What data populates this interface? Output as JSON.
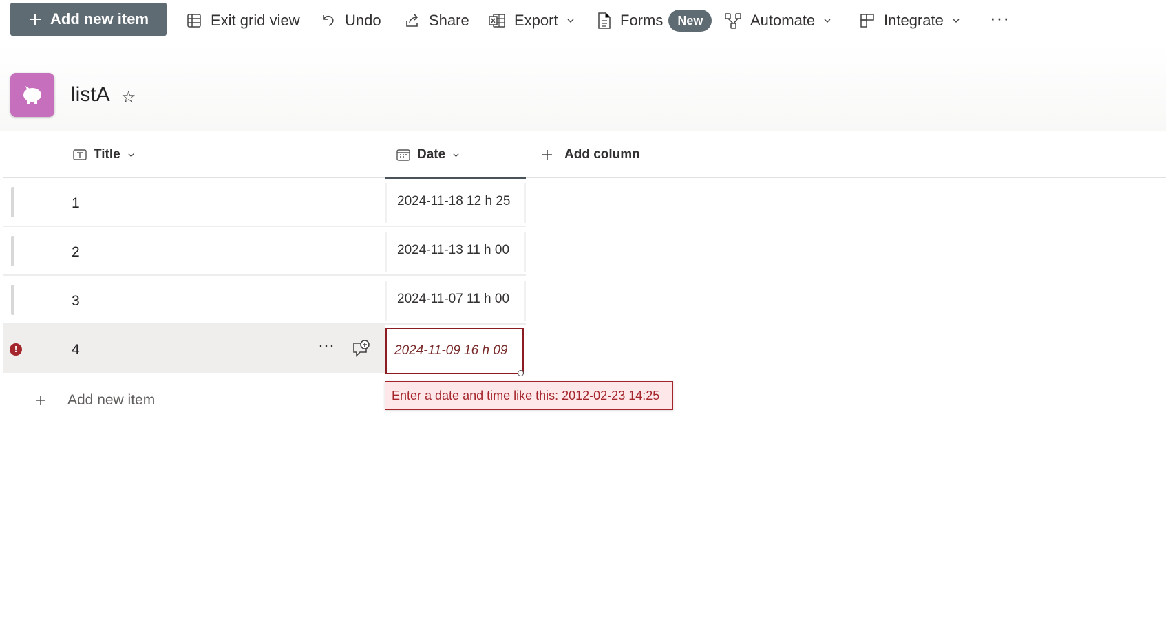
{
  "toolbar": {
    "add_new_item": "Add new item",
    "exit_grid_view": "Exit grid view",
    "undo": "Undo",
    "share": "Share",
    "export": "Export",
    "forms": "Forms",
    "forms_badge": "New",
    "automate": "Automate",
    "integrate": "Integrate",
    "more": "···"
  },
  "list": {
    "title": "listA",
    "star": "☆"
  },
  "columns": {
    "title": "Title",
    "date": "Date",
    "add_column": "Add column"
  },
  "rows": [
    {
      "title": "1",
      "date": "2024-11-18 12 h 25"
    },
    {
      "title": "2",
      "date": "2024-11-13 11 h 00"
    },
    {
      "title": "3",
      "date": "2024-11-07 11 h 00"
    },
    {
      "title": "4",
      "date": "2024-11-09 16 h 09"
    }
  ],
  "row_actions": {
    "more": "···"
  },
  "error": {
    "icon": "!",
    "message": "Enter a date and time like this: 2012-02-23 14:25"
  },
  "footer": {
    "add_new_item": "Add new item"
  },
  "colors": {
    "accent": "#5f6b73",
    "error": "#a4262c",
    "list_icon": "#c66fbd"
  }
}
